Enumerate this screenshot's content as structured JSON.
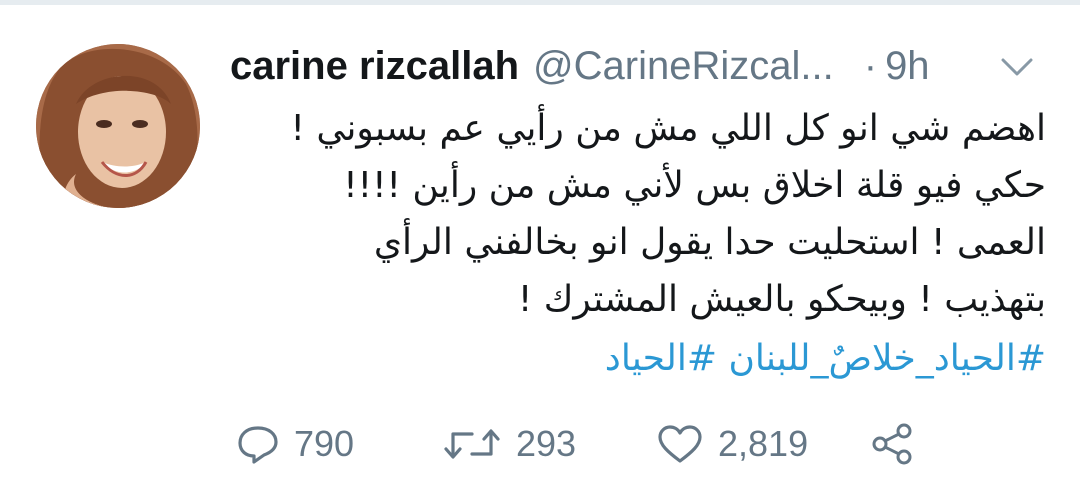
{
  "colors": {
    "text": "#14171a",
    "secondary": "#657786",
    "hashtag": "#2b98d4",
    "divider": "#e6ecf0"
  },
  "tweet": {
    "display_name": "carine rizcallah",
    "handle": "@CarineRizcal...",
    "separator": "·",
    "time": "9h",
    "avatar_icon": "profile-photo",
    "menu_icon": "chevron-down-icon",
    "lines": [
      "اهضم شي انو كل اللي مش من رأيي عم بسبوني !",
      "حكي فيو قلة اخلاق بس لأني مش من رأين !!!!",
      "العمى ! استحليت حدا يقول انو بخالفني الرأي",
      "بتهذيب ! وبيحكو بالعيش المشترك !"
    ],
    "hashtags": [
      "#الحياد_خلاصٌ_للبنان",
      "#الحياد"
    ]
  },
  "actions": {
    "reply_count": "790",
    "retweet_count": "293",
    "like_count": "2,819"
  }
}
